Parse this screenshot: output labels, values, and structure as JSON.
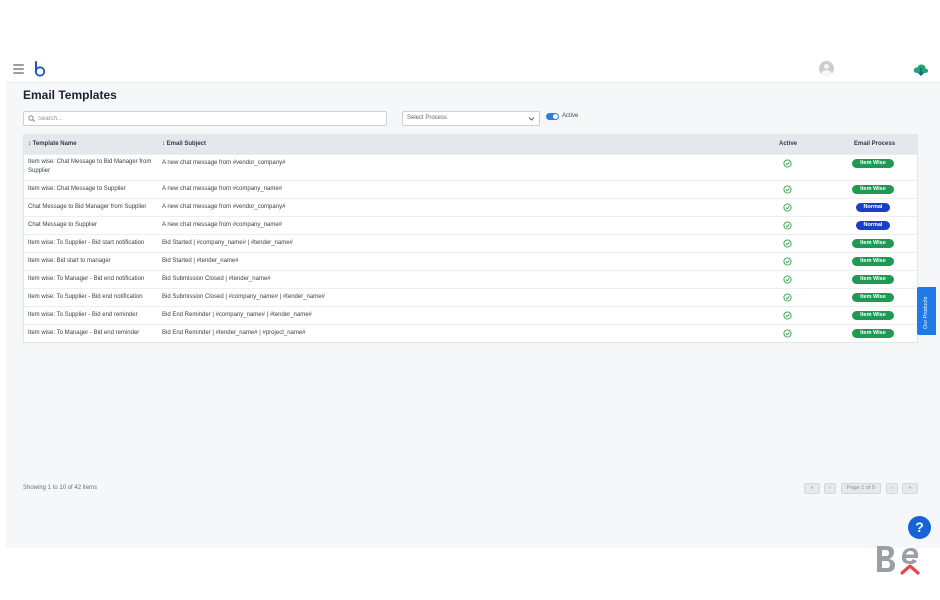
{
  "page": {
    "title": "Email Templates"
  },
  "filters": {
    "search_placeholder": "Search...",
    "process_select": "Select Process",
    "active_toggle_label": "Active",
    "active_toggle_on": true
  },
  "table": {
    "columns": [
      "↕ Template Name",
      "↕ Email Subject",
      "Active",
      "Email Process"
    ],
    "rows": [
      {
        "name": "Item wise: Chat Message to Bid Manager from Supplier",
        "subject": "A new chat message from #vendor_company#",
        "active": true,
        "process": "Item Wise"
      },
      {
        "name": "Item wise: Chat Message to Supplier",
        "subject": "A new chat message from #company_name#",
        "active": true,
        "process": "Item Wise"
      },
      {
        "name": "Chat Message to Bid Manager from Supplier",
        "subject": "A new chat message from #vendor_company#",
        "active": true,
        "process": "Normal"
      },
      {
        "name": "Chat Message to Supplier",
        "subject": "A new chat message from #company_name#",
        "active": true,
        "process": "Normal"
      },
      {
        "name": "Item wise: To Supplier - Bid start notification",
        "subject": "Bid Started | #company_name# | #tender_name#",
        "active": true,
        "process": "Item Wise"
      },
      {
        "name": "Item wise: Bid start to manager",
        "subject": "Bid Started | #tender_name#",
        "active": true,
        "process": "Item Wise"
      },
      {
        "name": "Item wise: To Manager - Bid end notification",
        "subject": "Bid Submission Closed | #tender_name#",
        "active": true,
        "process": "Item Wise"
      },
      {
        "name": "Item wise: To Supplier - Bid end notification",
        "subject": "Bid Submission Closed | #company_name# | #tender_name#",
        "active": true,
        "process": "Item Wise"
      },
      {
        "name": "Item wise: To Supplier - Bid end reminder",
        "subject": "Bid End Reminder | #company_name# | #tender_name#",
        "active": true,
        "process": "Item Wise"
      },
      {
        "name": "Item wise: To Manager - Bid end reminder",
        "subject": "Bid End Reminder | #tender_name# | #project_name#",
        "active": true,
        "process": "Item Wise"
      }
    ]
  },
  "pagination": {
    "info": "Showing 1 to 10 of 42 items",
    "first": "«",
    "prev": "‹",
    "page_label": "Page 1 of 5",
    "next": "›",
    "last": "»"
  },
  "side_tab": {
    "label": "Our Products"
  },
  "help": {
    "label": "?"
  },
  "colors": {
    "item_wise": "#1e9a55",
    "normal": "#1a3fc4",
    "check": "#2e9d4e",
    "accent": "#1e7be8"
  },
  "icons": {
    "menu": "hamburger-icon",
    "logo": "app-logo",
    "user": "user-avatar-icon",
    "cloud": "cloud-icon",
    "search": "search-icon",
    "check": "check-circle-icon"
  }
}
